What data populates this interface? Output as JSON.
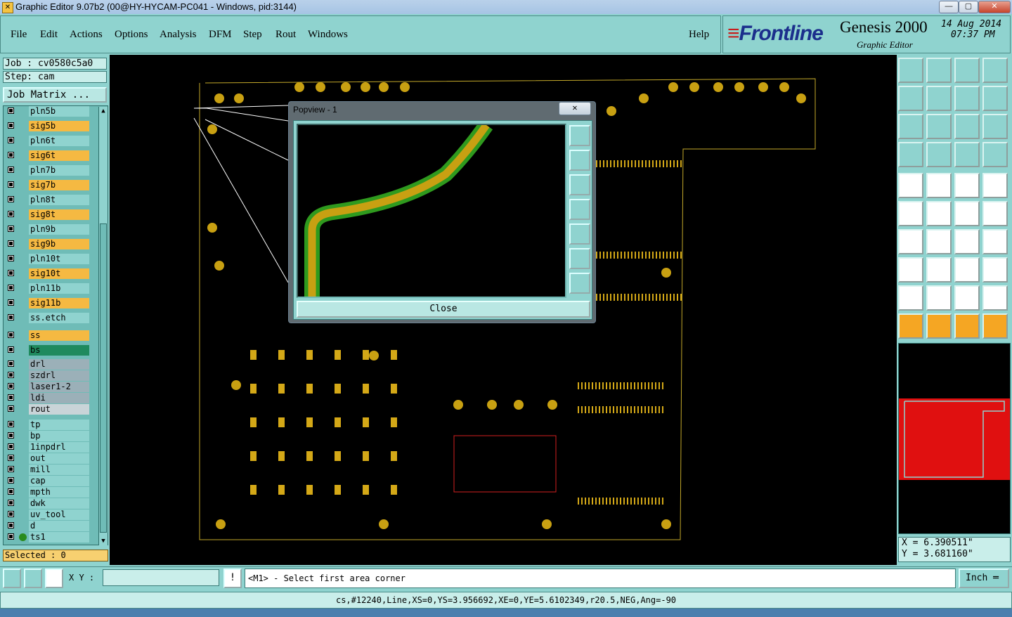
{
  "window": {
    "title": "Graphic Editor 9.07b2 (00@HY-HYCAM-PC041 - Windows, pid:3144)"
  },
  "menu": {
    "items": [
      "File",
      "Edit",
      "Actions",
      "Options",
      "Analysis",
      "DFM",
      "Step",
      "Rout",
      "Windows"
    ],
    "help": "Help"
  },
  "brand": {
    "logo": "Frontline",
    "product": "Genesis 2000",
    "subtitle": "Graphic Editor",
    "date": "14 Aug 2014",
    "time": "07:37 PM"
  },
  "job": {
    "job_label": "Job : cv0580c5a0",
    "step_label": "Step: cam",
    "matrix_button": "Job Matrix ..."
  },
  "layers": [
    {
      "name": "pln5b",
      "color": "#8fd3cf"
    },
    {
      "name": "sig5b",
      "color": "#f5b942"
    },
    {
      "name": "pln6t",
      "color": "#8fd3cf"
    },
    {
      "name": "sig6t",
      "color": "#f5b942"
    },
    {
      "name": "pln7b",
      "color": "#8fd3cf"
    },
    {
      "name": "sig7b",
      "color": "#f5b942"
    },
    {
      "name": "pln8t",
      "color": "#8fd3cf"
    },
    {
      "name": "sig8t",
      "color": "#f5b942"
    },
    {
      "name": "pln9b",
      "color": "#8fd3cf"
    },
    {
      "name": "sig9b",
      "color": "#f5b942"
    },
    {
      "name": "pln10t",
      "color": "#8fd3cf"
    },
    {
      "name": "sig10t",
      "color": "#f5b942"
    },
    {
      "name": "pln11b",
      "color": "#8fd3cf"
    },
    {
      "name": "sig11b",
      "color": "#f5b942"
    },
    {
      "name": "ss.etch",
      "color": "#8fd3cf"
    },
    {
      "name": "ss",
      "color": "#f5b942"
    },
    {
      "name": "bs",
      "color": "#1f8a5e"
    },
    {
      "name": "drl",
      "color": "#9bb0b8"
    },
    {
      "name": "szdrl",
      "color": "#9bb0b8"
    },
    {
      "name": "laser1-2",
      "color": "#9bb0b8"
    },
    {
      "name": "ldi",
      "color": "#9bb0b8"
    },
    {
      "name": "rout",
      "color": "#c9d4d8"
    },
    {
      "name": "tp",
      "color": "#8fd3cf"
    },
    {
      "name": "bp",
      "color": "#8fd3cf"
    },
    {
      "name": "1inpdrl",
      "color": "#8fd3cf"
    },
    {
      "name": "out",
      "color": "#8fd3cf"
    },
    {
      "name": "mill",
      "color": "#8fd3cf"
    },
    {
      "name": "cap",
      "color": "#8fd3cf"
    },
    {
      "name": "mpth",
      "color": "#8fd3cf"
    },
    {
      "name": "dwk",
      "color": "#8fd3cf"
    },
    {
      "name": "uv_tool",
      "color": "#8fd3cf"
    },
    {
      "name": "d",
      "color": "#8fd3cf"
    },
    {
      "name": "ts1",
      "color": "#8fd3cf"
    }
  ],
  "selected": "Selected : 0",
  "popup": {
    "title": "Popview - 1",
    "close_x": "✕",
    "close_button": "Close"
  },
  "coords": {
    "x": "X = 6.390511\"",
    "y": "Y = 3.681160\""
  },
  "bottom": {
    "xy_label": "X Y :",
    "xy_value": "",
    "prompt": "<M1> - Select first area corner",
    "units": "Inch"
  },
  "status_line": "cs,#12240,Line,XS=0,YS=3.956692,XE=0,YE=5.6102349,r20.5,NEG,Ang=-90"
}
